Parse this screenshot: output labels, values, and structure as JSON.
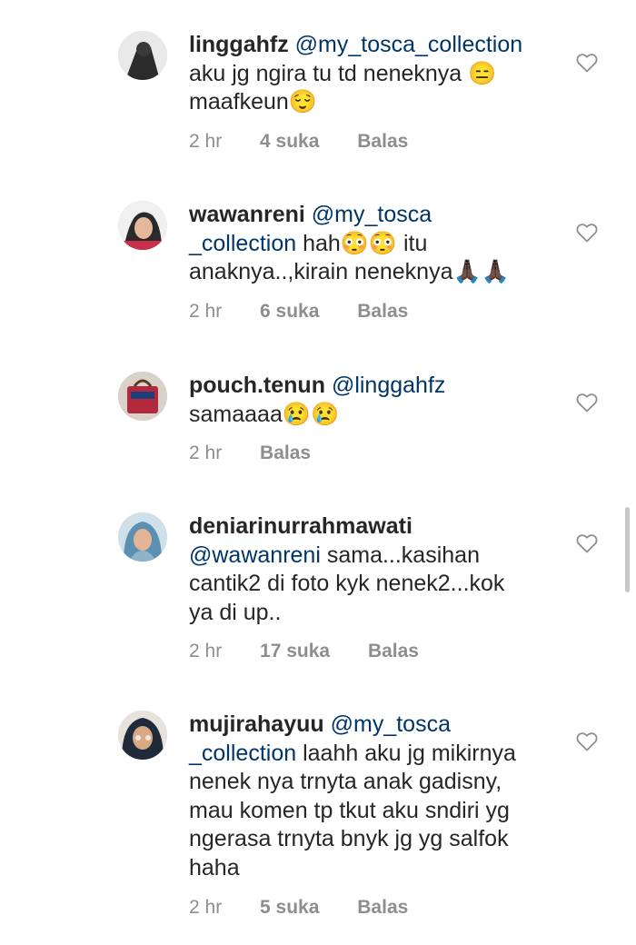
{
  "comments": [
    {
      "username": "linggahfz",
      "mention": "@my_tosca_collection",
      "text_lines": [
        "aku jg ngira tu td neneknya 😑",
        "maafkeun😌"
      ],
      "time": "2 hr",
      "likes": "4 suka",
      "reply": "Balas"
    },
    {
      "username": "wawanreni",
      "mention_line1": "@my_tosca",
      "mention_line2": "_collection",
      "text_after_mention": " hah😳😳 itu",
      "text_line3": "anaknya..,kirain neneknya🙏🏿🙏🏿",
      "time": "2 hr",
      "likes": "6 suka",
      "reply": "Balas"
    },
    {
      "username": "pouch.tenun",
      "mention": "@linggahfz",
      "text_line2": "samaaaa😢😢",
      "time": "2 hr",
      "reply": "Balas"
    },
    {
      "username": "deniarinurrahmawati",
      "mention": "@wawanreni",
      "text_after_mention": " sama...kasihan",
      "text_line3": "cantik2 di foto kyk nenek2...kok",
      "text_line4": "ya di up..",
      "time": "2 hr",
      "likes": "17 suka",
      "reply": "Balas"
    },
    {
      "username": "mujirahayuu",
      "mention_line1": "@my_tosca",
      "mention_line2": "_collection",
      "text_after_mention": " laahh aku jg mikirnya",
      "text_line3": "nenek nya trnyta anak gadisny,",
      "text_line4": "mau komen tp tkut aku sndiri yg",
      "text_line5": "ngerasa trnyta bnyk jg yg salfok",
      "text_line6": "haha",
      "time": "2 hr",
      "likes": "5 suka",
      "reply": "Balas"
    }
  ],
  "icons": {
    "like": "heart-outline-icon",
    "avatar": "profile-picture"
  },
  "colors": {
    "text": "#262626",
    "mention": "#003569",
    "meta": "#8e8e8e",
    "heart_stroke": "#8e8e8e"
  }
}
